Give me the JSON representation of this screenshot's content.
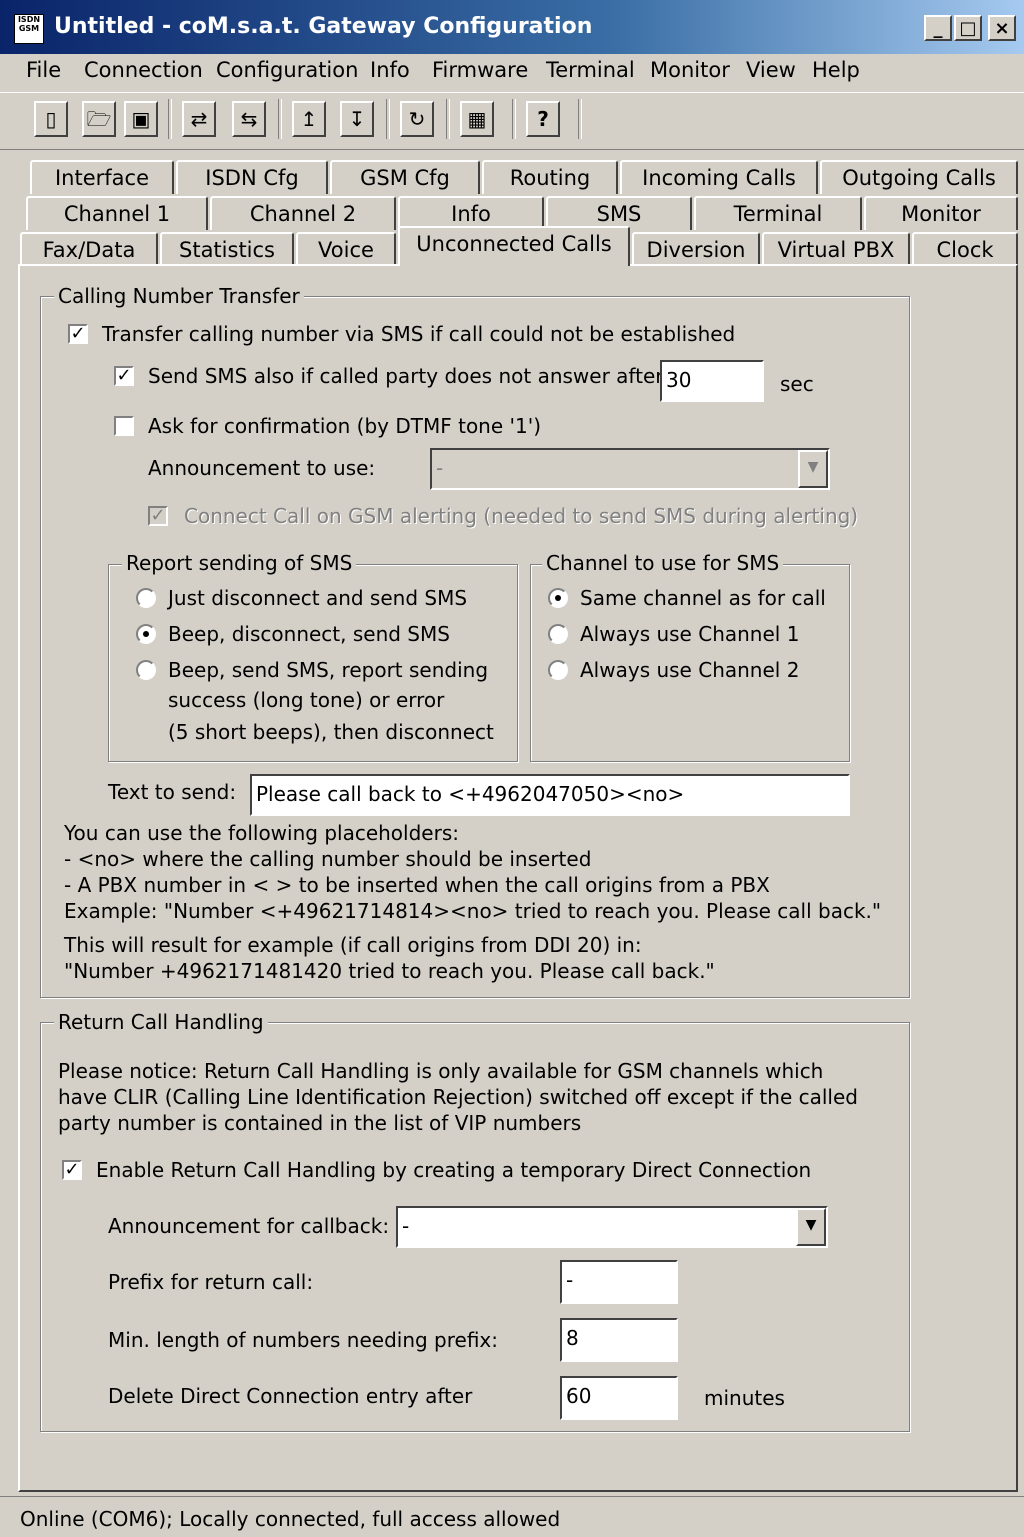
{
  "window": {
    "title": "Untitled - coM.s.a.t. Gateway Configuration",
    "app_icon_text": "ISDN GSM",
    "minimize": "_",
    "maximize": "□",
    "close": "×"
  },
  "menu": [
    "File",
    "Connection",
    "Configuration",
    "Info",
    "Firmware",
    "Terminal",
    "Monitor",
    "View",
    "Help"
  ],
  "toolbar": {
    "icons": [
      "new-document-icon",
      "open-folder-icon",
      "save-disk-icon",
      "connect-icon",
      "disconnect-icon",
      "upload-config-icon",
      "download-config-icon",
      "refresh-icon",
      "monitor-icon",
      "help-icon"
    ],
    "help_glyph": "?"
  },
  "tabs": {
    "row1": [
      "Interface",
      "ISDN Cfg",
      "GSM Cfg",
      "Routing",
      "Incoming Calls",
      "Outgoing Calls"
    ],
    "row2": [
      "Channel 1",
      "Channel 2",
      "Info",
      "SMS",
      "Terminal",
      "Monitor"
    ],
    "row3": [
      "Fax/Data",
      "Statistics",
      "Voice",
      "Unconnected Calls",
      "Diversion",
      "Virtual PBX",
      "Clock"
    ],
    "active": "Unconnected Calls"
  },
  "calling_number_transfer": {
    "title": "Calling Number Transfer",
    "transfer_label": "Transfer calling number via SMS if call could not be established",
    "transfer_checked": true,
    "send_sms_label": "Send SMS also if called party does not answer after",
    "send_sms_checked": true,
    "send_sms_value": "30",
    "send_sms_unit": "sec",
    "confirm_label": "Ask for confirmation (by DTMF tone '1')",
    "confirm_checked": false,
    "announcement_label": "Announcement to use:",
    "announcement_value": "-",
    "connect_alerting_label": "Connect Call on GSM alerting (needed to send SMS during alerting)",
    "connect_alerting_checked": true,
    "report": {
      "title": "Report sending of SMS",
      "options": [
        "Just disconnect and send SMS",
        "Beep, disconnect, send SMS",
        "Beep, send SMS, report sending",
        "success (long tone) or error",
        "(5 short beeps), then disconnect"
      ],
      "selected": 1
    },
    "channel": {
      "title": "Channel to use for SMS",
      "options": [
        "Same channel as for call",
        "Always use Channel 1",
        "Always use Channel 2"
      ],
      "selected": 0
    },
    "text_label": "Text to send:",
    "text_value": "Please call back to <+4962047050><no>",
    "help_lines": [
      "You can use the following placeholders:",
      "- <no> where the calling number should be inserted",
      "- A PBX number in < > to be inserted when the call origins from a PBX",
      "Example: \"Number <+49621714814><no> tried to reach you. Please call back.\""
    ],
    "result_lines": [
      "This will result for example (if call origins from DDI 20) in:",
      "\"Number +4962171481420 tried to reach you. Please call back.\""
    ]
  },
  "return_call": {
    "title": "Return Call Handling",
    "notice_lines": [
      "Please notice: Return Call Handling is only available for GSM channels which",
      "have CLIR (Calling Line Identification Rejection) switched off except if the called",
      "party number is contained in the list of VIP numbers"
    ],
    "enable_label": "Enable Return Call Handling by creating a temporary Direct Connection",
    "enable_checked": true,
    "announcement_label": "Announcement for callback:",
    "announcement_value": "-",
    "prefix_label": "Prefix for return call:",
    "prefix_value": "-",
    "minlen_label": "Min. length of numbers needing prefix:",
    "minlen_value": "8",
    "delete_label": "Delete Direct Connection entry after",
    "delete_value": "60",
    "delete_unit": "minutes"
  },
  "status": "Online (COM6); Locally connected, full access allowed"
}
